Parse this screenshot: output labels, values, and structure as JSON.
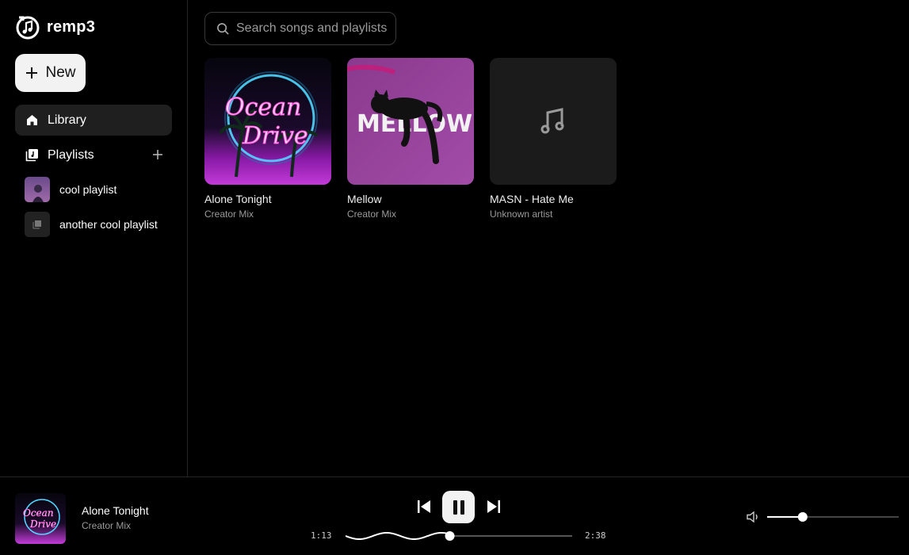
{
  "app": {
    "name": "remp3"
  },
  "sidebar": {
    "new_label": "New",
    "library_label": "Library",
    "playlists_label": "Playlists",
    "playlists": [
      {
        "name": "cool playlist",
        "has_cover": true
      },
      {
        "name": "another cool playlist",
        "has_cover": false
      }
    ]
  },
  "search": {
    "placeholder": "Search songs and playlists",
    "value": ""
  },
  "library": {
    "items": [
      {
        "title": "Alone Tonight",
        "subtitle": "Creator Mix",
        "cover": "ocean-drive-art"
      },
      {
        "title": "Mellow",
        "subtitle": "Creator Mix",
        "cover": "mellow-cat-art",
        "cover_text": "MELLOW"
      },
      {
        "title": "MASN - Hate Me",
        "subtitle": "Unknown artist",
        "cover": "music-note-placeholder"
      }
    ]
  },
  "player": {
    "title": "Alone Tonight",
    "artist": "Creator Mix",
    "elapsed": "1:13",
    "duration": "2:38",
    "progress": 0.46,
    "volume": 0.27,
    "state": "playing"
  },
  "colors": {
    "accent": "#f2f2f2",
    "background": "#000000",
    "surface": "#1f1f1f",
    "muted": "#9a9a9a"
  }
}
